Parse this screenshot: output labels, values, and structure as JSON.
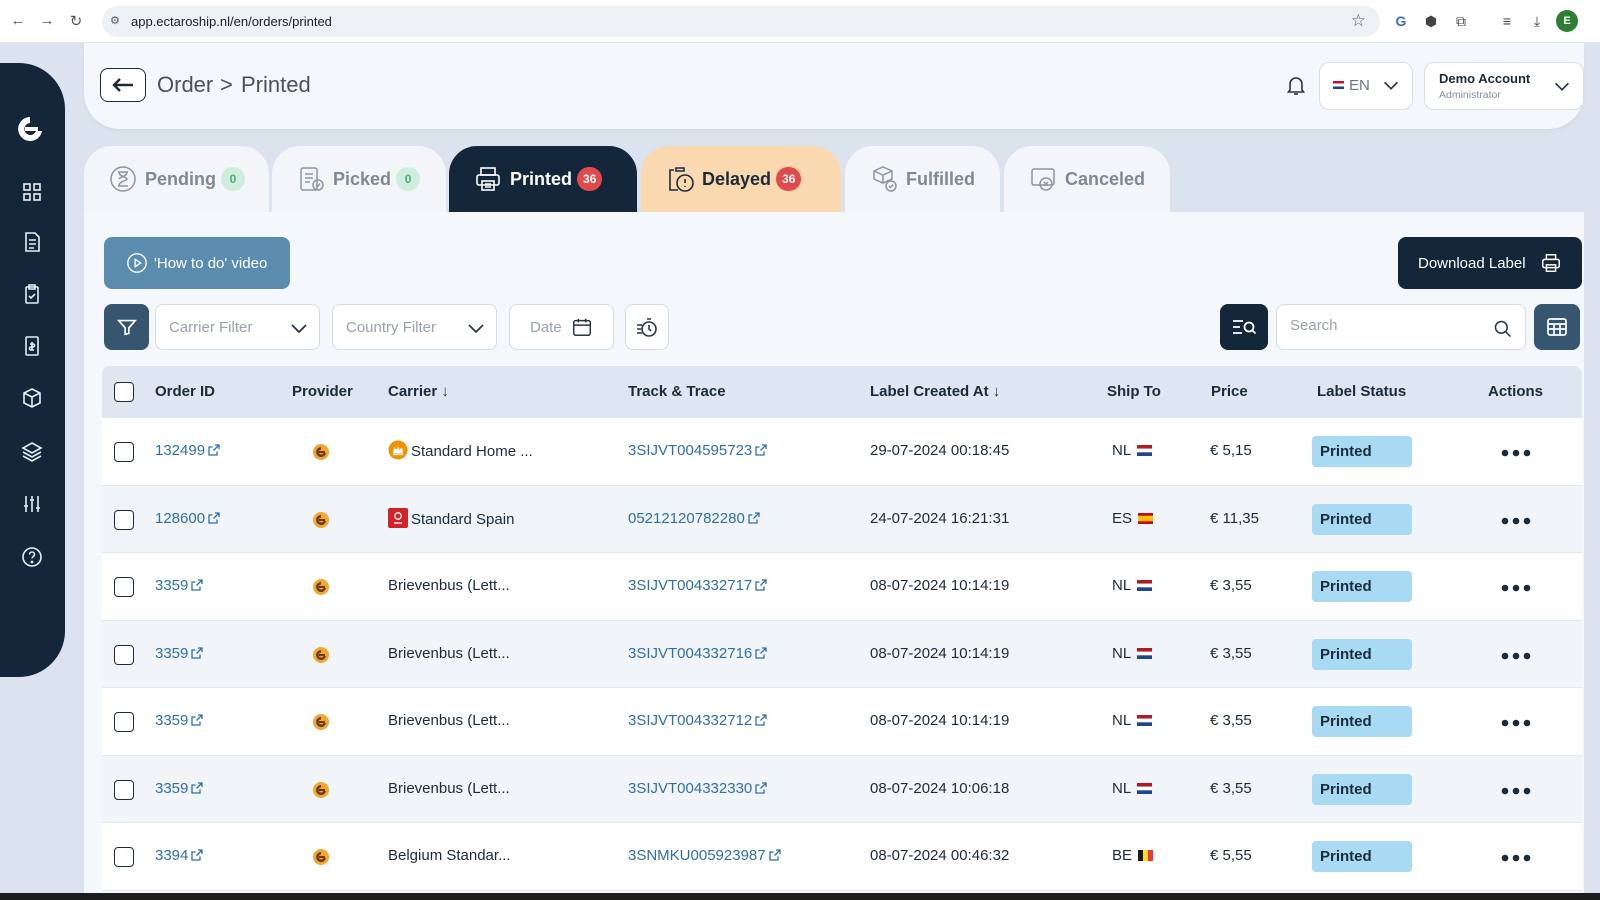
{
  "browser": {
    "url": "app.ectaroship.nl/en/orders/printed"
  },
  "header": {
    "breadcrumb_root": "Order",
    "breadcrumb_sep": ">",
    "breadcrumb_current": "Printed",
    "language": "EN",
    "account_name": "Demo Account",
    "account_role": "Administrator"
  },
  "tabs": [
    {
      "label": "Pending",
      "count": "0",
      "state": "inactive"
    },
    {
      "label": "Picked",
      "count": "0",
      "state": "inactive"
    },
    {
      "label": "Printed",
      "count": "36",
      "state": "active"
    },
    {
      "label": "Delayed",
      "count": "36",
      "state": "warning"
    },
    {
      "label": "Fulfilled",
      "count": "",
      "state": "inactive"
    },
    {
      "label": "Canceled",
      "count": "",
      "state": "inactive"
    }
  ],
  "toolbar": {
    "howto_label": "'How to do' video",
    "download_label": "Download Label",
    "carrier_placeholder": "Carrier Filter",
    "country_placeholder": "Country Filter",
    "date_placeholder": "Date",
    "search_placeholder": "Search"
  },
  "table": {
    "columns": [
      "Order ID",
      "Provider",
      "Carrier ↓",
      "Track & Trace",
      "Label Created At ↓",
      "Ship To",
      "Price",
      "Label Status",
      "Actions"
    ],
    "rows": [
      {
        "order_id": "132499",
        "carrier": "Standard Home ...",
        "carrier_logo": "crown-logo",
        "track": "3SIJVT004595723",
        "created": "29-07-2024 00:18:45",
        "ship_to": "NL",
        "price": "€ 5,15",
        "status": "Printed"
      },
      {
        "order_id": "128600",
        "carrier": "Standard Spain",
        "carrier_logo": "correos-logo",
        "track": "05212120782280",
        "created": "24-07-2024 16:21:31",
        "ship_to": "ES",
        "price": "€ 11,35",
        "status": "Printed"
      },
      {
        "order_id": "3359",
        "carrier": "Brievenbus (Lett...",
        "carrier_logo": "",
        "track": "3SIJVT004332717",
        "created": "08-07-2024 10:14:19",
        "ship_to": "NL",
        "price": "€ 3,55",
        "status": "Printed"
      },
      {
        "order_id": "3359",
        "carrier": "Brievenbus (Lett...",
        "carrier_logo": "",
        "track": "3SIJVT004332716",
        "created": "08-07-2024 10:14:19",
        "ship_to": "NL",
        "price": "€ 3,55",
        "status": "Printed"
      },
      {
        "order_id": "3359",
        "carrier": "Brievenbus (Lett...",
        "carrier_logo": "",
        "track": "3SIJVT004332712",
        "created": "08-07-2024 10:14:19",
        "ship_to": "NL",
        "price": "€ 3,55",
        "status": "Printed"
      },
      {
        "order_id": "3359",
        "carrier": "Brievenbus (Lett...",
        "carrier_logo": "",
        "track": "3SIJVT004332330",
        "created": "08-07-2024 10:06:18",
        "ship_to": "NL",
        "price": "€ 3,55",
        "status": "Printed"
      },
      {
        "order_id": "3394",
        "carrier": "Belgium Standar...",
        "carrier_logo": "",
        "track": "3SNMKU005923987",
        "created": "08-07-2024 00:46:32",
        "ship_to": "BE",
        "price": "€ 5,55",
        "status": "Printed"
      }
    ]
  },
  "colors": {
    "navy": "#13263a",
    "status_bg": "#a9daf3",
    "link": "#2f6fa8",
    "badge_red": "#e04a4a",
    "delayed_bg": "#fad8b0"
  }
}
